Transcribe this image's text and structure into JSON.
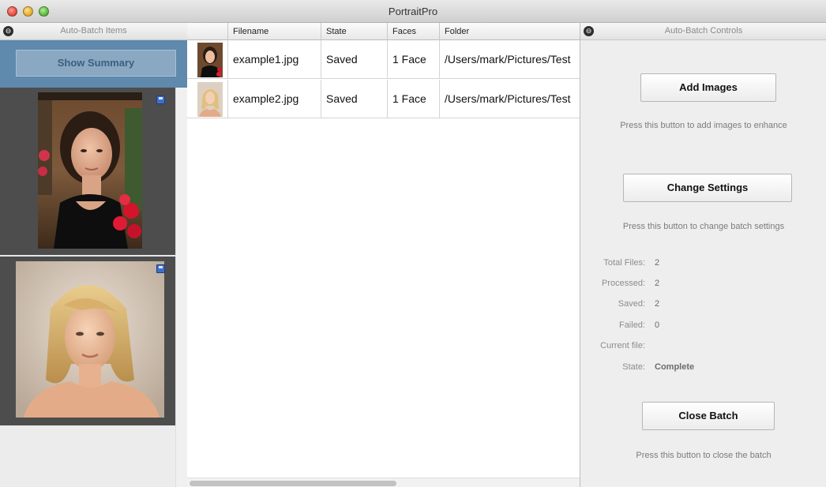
{
  "window": {
    "title": "PortraitPro"
  },
  "left_panel": {
    "header": "Auto-Batch Items",
    "show_summary_label": "Show Summary"
  },
  "table": {
    "columns": [
      "",
      "Filename",
      "State",
      "Faces",
      "Folder"
    ],
    "rows": [
      {
        "filename": "example1.jpg",
        "state": "Saved",
        "faces": "1 Face",
        "folder": "/Users/mark/Pictures/Test"
      },
      {
        "filename": "example2.jpg",
        "state": "Saved",
        "faces": "1 Face",
        "folder": "/Users/mark/Pictures/Test"
      }
    ]
  },
  "right_panel": {
    "header": "Auto-Batch Controls",
    "add_images_label": "Add Images",
    "add_images_hint": "Press this button to add images to enhance",
    "change_settings_label": "Change Settings",
    "change_settings_hint": "Press this button to change batch settings",
    "stats": {
      "total_files_label": "Total Files:",
      "total_files_value": "2",
      "processed_label": "Processed:",
      "processed_value": "2",
      "saved_label": "Saved:",
      "saved_value": "2",
      "failed_label": "Failed:",
      "failed_value": "0",
      "current_file_label": "Current file:",
      "current_file_value": "",
      "state_label": "State:",
      "state_value": "Complete"
    },
    "close_batch_label": "Close Batch",
    "close_batch_hint": "Press this button to close the batch"
  },
  "colors": {
    "summary_bar": "#5f89ad",
    "save_icon": "#3f70c6"
  },
  "icons": [
    "window-close-icon",
    "window-minimize-icon",
    "window-zoom-icon",
    "panel-detach-icon",
    "save-icon",
    "portrait-photo"
  ]
}
